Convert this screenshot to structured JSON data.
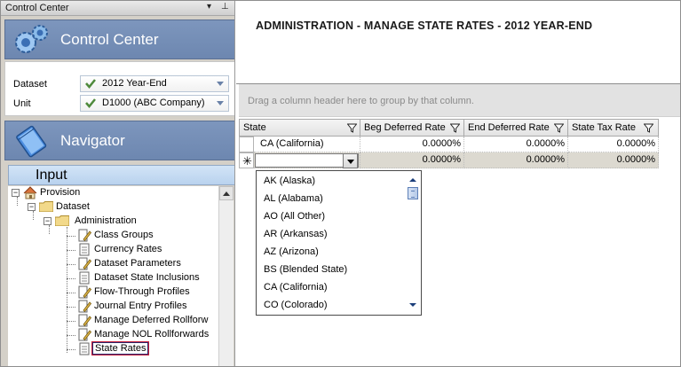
{
  "left_pane": {
    "title": "Control Center",
    "control_center_label": "Control Center",
    "navigator_label": "Navigator",
    "dataset_label": "Dataset",
    "dataset_value": "2012 Year-End",
    "unit_label": "Unit",
    "unit_value": "D1000 (ABC Company)",
    "input_header": "Input"
  },
  "tree": {
    "provision": "Provision",
    "dataset": "Dataset",
    "administration": "Administration",
    "items": [
      "Class Groups",
      "Currency Rates",
      "Dataset Parameters",
      "Dataset State Inclusions",
      "Flow-Through Profiles",
      "Journal Entry Profiles",
      "Manage Deferred Rollforw",
      "Manage NOL Rollforwards",
      "State Rates"
    ]
  },
  "main": {
    "title": "ADMINISTRATION - MANAGE STATE RATES - 2012 YEAR-END",
    "group_by_hint": "Drag a column header here to group by that column.",
    "columns": [
      "State",
      "Beg Deferred Rate",
      "End Deferred Rate",
      "State Tax Rate"
    ],
    "rows": [
      {
        "state": "CA (California)",
        "beg": "0.0000%",
        "end": "0.0000%",
        "tax": "0.0000%"
      },
      {
        "state": "",
        "beg": "0.0000%",
        "end": "0.0000%",
        "tax": "0.0000%"
      }
    ],
    "new_row_marker": "✳",
    "state_options": [
      "AK (Alaska)",
      "AL (Alabama)",
      "AO (All Other)",
      "AR (Arkansas)",
      "AZ (Arizona)",
      "BS (Blended State)",
      "CA (California)",
      "CO (Colorado)"
    ]
  },
  "colors": {
    "banner": "#7890b8",
    "selected_border": "#c81e3a",
    "check": "#4f8a3c"
  }
}
